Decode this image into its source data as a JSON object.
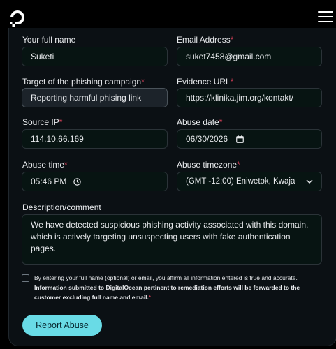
{
  "header": {
    "logo_icon": "digitalocean-logo-icon",
    "menu_icon": "hamburger-menu-icon"
  },
  "form": {
    "full_name": {
      "label": "Your full name",
      "value": "Suketi"
    },
    "email": {
      "label": "Email Address",
      "required_mark": "*",
      "value": "suket7458@gmail.com"
    },
    "target": {
      "label": "Target of the phishing campaign",
      "required_mark": "*",
      "value": "Reporting harmful phising link"
    },
    "evidence_url": {
      "label": "Evidence URL",
      "required_mark": "*",
      "value": "https://klinika.jim.org/kontakt/"
    },
    "source_ip": {
      "label": "Source IP",
      "required_mark": "*",
      "value": "114.10.66.169"
    },
    "abuse_date": {
      "label": "Abuse date",
      "required_mark": "*",
      "value": "06/30/2026",
      "icon": "calendar-icon"
    },
    "abuse_time": {
      "label": "Abuse time",
      "required_mark": "*",
      "value": "05:46 PM",
      "icon": "clock-icon"
    },
    "abuse_timezone": {
      "label": "Abuse timezone",
      "required_mark": "*",
      "value": "(GMT -12:00) Eniwetok, Kwaja",
      "icon": "chevron-down-icon"
    },
    "description": {
      "label": "Description/comment",
      "value": "We have detected suspicious phishing activity associated with this domain, which is actively targeting unsuspecting users with fake authentication pages."
    },
    "consent": {
      "text_normal": "By entering your full name (optional) or email, you affirm all information entered is true and accurate.",
      "text_bold": "Information submitted to DigitalOcean pertinent to remediation efforts will be forwarded to the customer excluding full name and email.",
      "required_mark": "*"
    },
    "submit_label": "Report Abuse"
  },
  "colors": {
    "accent": "#69dbe6",
    "required": "#e2425c",
    "background": "#000000",
    "card": "#0b1014"
  }
}
